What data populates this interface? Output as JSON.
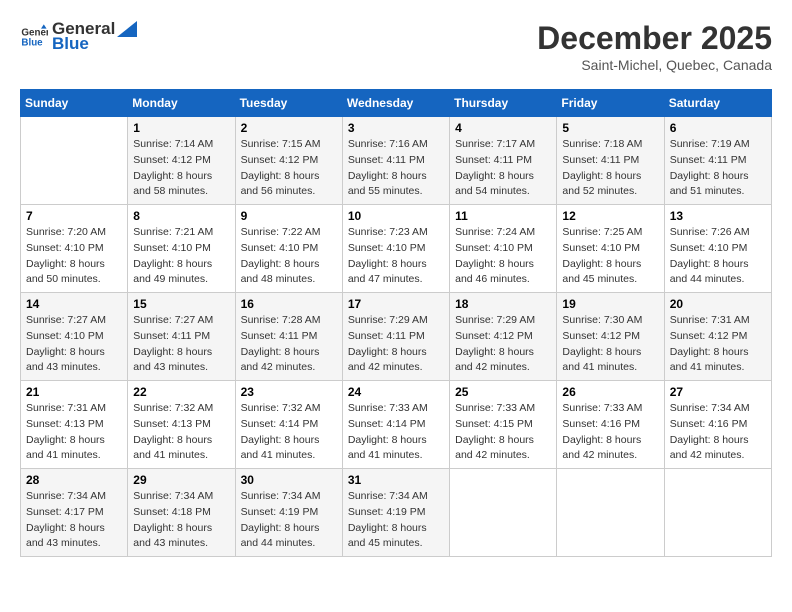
{
  "header": {
    "logo_general": "General",
    "logo_blue": "Blue",
    "month": "December 2025",
    "location": "Saint-Michel, Quebec, Canada"
  },
  "days_of_week": [
    "Sunday",
    "Monday",
    "Tuesday",
    "Wednesday",
    "Thursday",
    "Friday",
    "Saturday"
  ],
  "weeks": [
    [
      {
        "day": "",
        "sunrise": "",
        "sunset": "",
        "daylight": ""
      },
      {
        "day": "1",
        "sunrise": "Sunrise: 7:14 AM",
        "sunset": "Sunset: 4:12 PM",
        "daylight": "Daylight: 8 hours and 58 minutes."
      },
      {
        "day": "2",
        "sunrise": "Sunrise: 7:15 AM",
        "sunset": "Sunset: 4:12 PM",
        "daylight": "Daylight: 8 hours and 56 minutes."
      },
      {
        "day": "3",
        "sunrise": "Sunrise: 7:16 AM",
        "sunset": "Sunset: 4:11 PM",
        "daylight": "Daylight: 8 hours and 55 minutes."
      },
      {
        "day": "4",
        "sunrise": "Sunrise: 7:17 AM",
        "sunset": "Sunset: 4:11 PM",
        "daylight": "Daylight: 8 hours and 54 minutes."
      },
      {
        "day": "5",
        "sunrise": "Sunrise: 7:18 AM",
        "sunset": "Sunset: 4:11 PM",
        "daylight": "Daylight: 8 hours and 52 minutes."
      },
      {
        "day": "6",
        "sunrise": "Sunrise: 7:19 AM",
        "sunset": "Sunset: 4:11 PM",
        "daylight": "Daylight: 8 hours and 51 minutes."
      }
    ],
    [
      {
        "day": "7",
        "sunrise": "Sunrise: 7:20 AM",
        "sunset": "Sunset: 4:10 PM",
        "daylight": "Daylight: 8 hours and 50 minutes."
      },
      {
        "day": "8",
        "sunrise": "Sunrise: 7:21 AM",
        "sunset": "Sunset: 4:10 PM",
        "daylight": "Daylight: 8 hours and 49 minutes."
      },
      {
        "day": "9",
        "sunrise": "Sunrise: 7:22 AM",
        "sunset": "Sunset: 4:10 PM",
        "daylight": "Daylight: 8 hours and 48 minutes."
      },
      {
        "day": "10",
        "sunrise": "Sunrise: 7:23 AM",
        "sunset": "Sunset: 4:10 PM",
        "daylight": "Daylight: 8 hours and 47 minutes."
      },
      {
        "day": "11",
        "sunrise": "Sunrise: 7:24 AM",
        "sunset": "Sunset: 4:10 PM",
        "daylight": "Daylight: 8 hours and 46 minutes."
      },
      {
        "day": "12",
        "sunrise": "Sunrise: 7:25 AM",
        "sunset": "Sunset: 4:10 PM",
        "daylight": "Daylight: 8 hours and 45 minutes."
      },
      {
        "day": "13",
        "sunrise": "Sunrise: 7:26 AM",
        "sunset": "Sunset: 4:10 PM",
        "daylight": "Daylight: 8 hours and 44 minutes."
      }
    ],
    [
      {
        "day": "14",
        "sunrise": "Sunrise: 7:27 AM",
        "sunset": "Sunset: 4:10 PM",
        "daylight": "Daylight: 8 hours and 43 minutes."
      },
      {
        "day": "15",
        "sunrise": "Sunrise: 7:27 AM",
        "sunset": "Sunset: 4:11 PM",
        "daylight": "Daylight: 8 hours and 43 minutes."
      },
      {
        "day": "16",
        "sunrise": "Sunrise: 7:28 AM",
        "sunset": "Sunset: 4:11 PM",
        "daylight": "Daylight: 8 hours and 42 minutes."
      },
      {
        "day": "17",
        "sunrise": "Sunrise: 7:29 AM",
        "sunset": "Sunset: 4:11 PM",
        "daylight": "Daylight: 8 hours and 42 minutes."
      },
      {
        "day": "18",
        "sunrise": "Sunrise: 7:29 AM",
        "sunset": "Sunset: 4:12 PM",
        "daylight": "Daylight: 8 hours and 42 minutes."
      },
      {
        "day": "19",
        "sunrise": "Sunrise: 7:30 AM",
        "sunset": "Sunset: 4:12 PM",
        "daylight": "Daylight: 8 hours and 41 minutes."
      },
      {
        "day": "20",
        "sunrise": "Sunrise: 7:31 AM",
        "sunset": "Sunset: 4:12 PM",
        "daylight": "Daylight: 8 hours and 41 minutes."
      }
    ],
    [
      {
        "day": "21",
        "sunrise": "Sunrise: 7:31 AM",
        "sunset": "Sunset: 4:13 PM",
        "daylight": "Daylight: 8 hours and 41 minutes."
      },
      {
        "day": "22",
        "sunrise": "Sunrise: 7:32 AM",
        "sunset": "Sunset: 4:13 PM",
        "daylight": "Daylight: 8 hours and 41 minutes."
      },
      {
        "day": "23",
        "sunrise": "Sunrise: 7:32 AM",
        "sunset": "Sunset: 4:14 PM",
        "daylight": "Daylight: 8 hours and 41 minutes."
      },
      {
        "day": "24",
        "sunrise": "Sunrise: 7:33 AM",
        "sunset": "Sunset: 4:14 PM",
        "daylight": "Daylight: 8 hours and 41 minutes."
      },
      {
        "day": "25",
        "sunrise": "Sunrise: 7:33 AM",
        "sunset": "Sunset: 4:15 PM",
        "daylight": "Daylight: 8 hours and 42 minutes."
      },
      {
        "day": "26",
        "sunrise": "Sunrise: 7:33 AM",
        "sunset": "Sunset: 4:16 PM",
        "daylight": "Daylight: 8 hours and 42 minutes."
      },
      {
        "day": "27",
        "sunrise": "Sunrise: 7:34 AM",
        "sunset": "Sunset: 4:16 PM",
        "daylight": "Daylight: 8 hours and 42 minutes."
      }
    ],
    [
      {
        "day": "28",
        "sunrise": "Sunrise: 7:34 AM",
        "sunset": "Sunset: 4:17 PM",
        "daylight": "Daylight: 8 hours and 43 minutes."
      },
      {
        "day": "29",
        "sunrise": "Sunrise: 7:34 AM",
        "sunset": "Sunset: 4:18 PM",
        "daylight": "Daylight: 8 hours and 43 minutes."
      },
      {
        "day": "30",
        "sunrise": "Sunrise: 7:34 AM",
        "sunset": "Sunset: 4:19 PM",
        "daylight": "Daylight: 8 hours and 44 minutes."
      },
      {
        "day": "31",
        "sunrise": "Sunrise: 7:34 AM",
        "sunset": "Sunset: 4:19 PM",
        "daylight": "Daylight: 8 hours and 45 minutes."
      },
      {
        "day": "",
        "sunrise": "",
        "sunset": "",
        "daylight": ""
      },
      {
        "day": "",
        "sunrise": "",
        "sunset": "",
        "daylight": ""
      },
      {
        "day": "",
        "sunrise": "",
        "sunset": "",
        "daylight": ""
      }
    ]
  ]
}
